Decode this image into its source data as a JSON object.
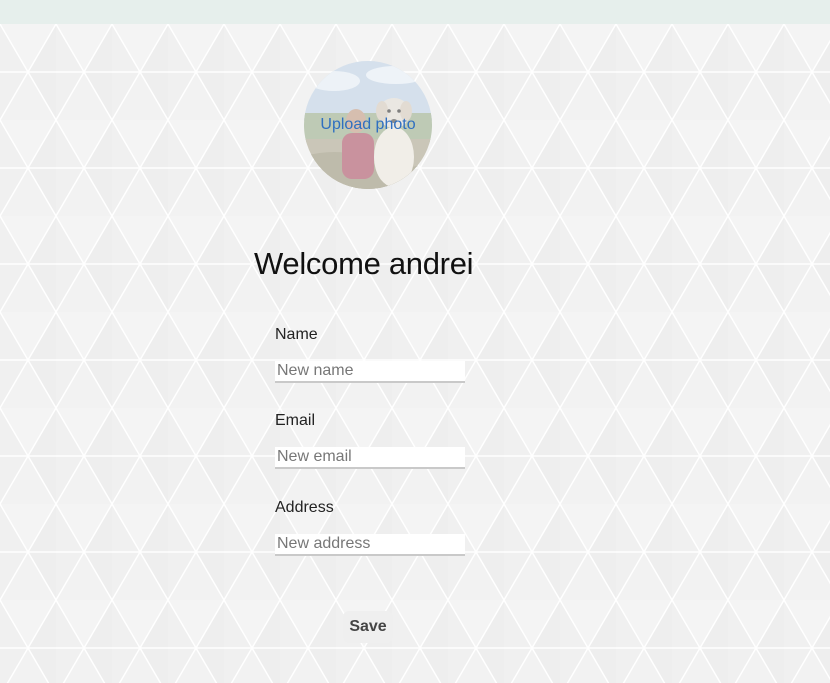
{
  "profile": {
    "upload_label": "Upload photo",
    "welcome": "Welcome andrei"
  },
  "form": {
    "name": {
      "label": "Name",
      "placeholder": "New name",
      "value": ""
    },
    "email": {
      "label": "Email",
      "placeholder": "New email",
      "value": ""
    },
    "address": {
      "label": "Address",
      "placeholder": "New address",
      "value": ""
    },
    "save_label": "Save"
  },
  "colors": {
    "background": "#f7f8f8",
    "top_bar": "#e6efec",
    "link": "#2f6fc0",
    "button_bg": "#efefef"
  }
}
